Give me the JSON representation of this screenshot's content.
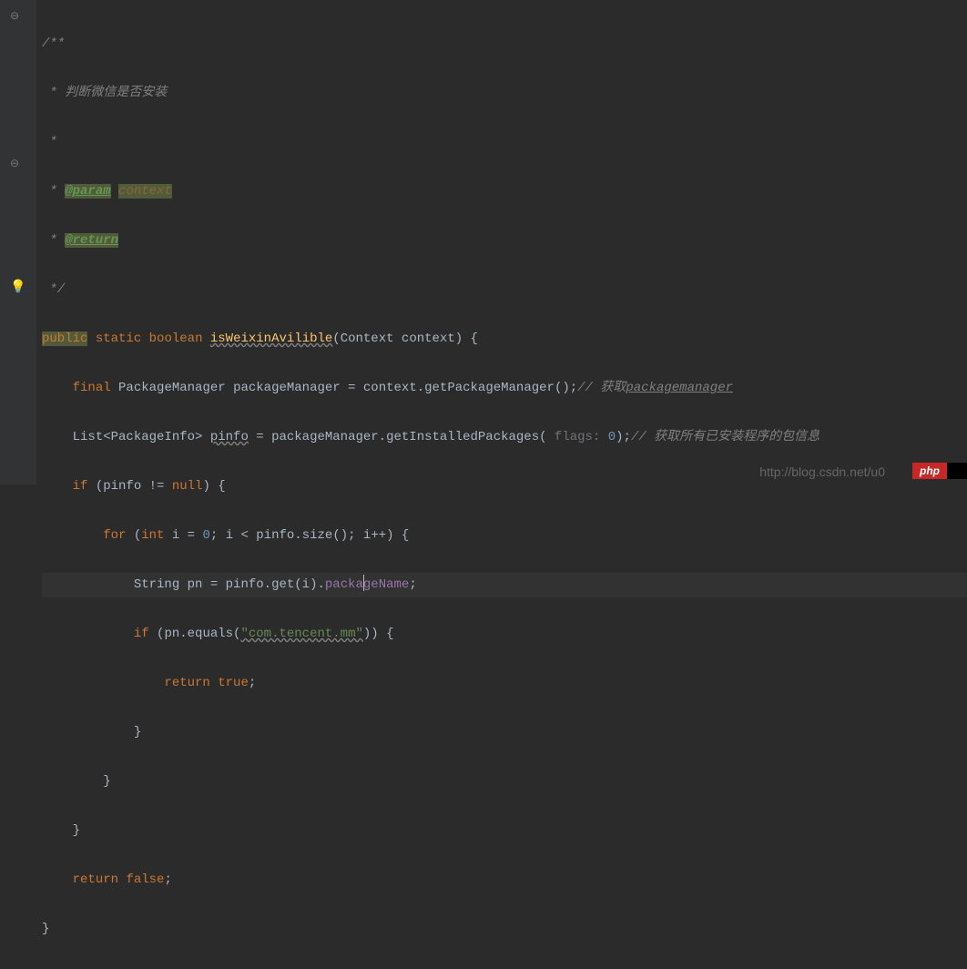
{
  "code": {
    "doc_open": "/**",
    "doc_desc": " * 判断微信是否安装",
    "doc_empty": " *",
    "doc_param_tag": "@param",
    "doc_param_name": "context",
    "doc_return_tag": "@return",
    "doc_close": " */",
    "kw_public": "public",
    "kw_static": "static",
    "kw_boolean": "boolean",
    "method_name": "isWeixinAvilible",
    "param_type": "Context",
    "param_name": "context",
    "brace_open": " {",
    "kw_final": "final",
    "type_pm": "PackageManager",
    "var_pm": "packageManager",
    "assign": " = ",
    "ctx": "context",
    "call_getpm": ".getPackageManager();",
    "cmt1": "// 获取",
    "cmt1b": "packagemanager",
    "type_list": "List<PackageInfo>",
    "var_pinfo": "pinfo",
    "call_getinst": " = packageManager.getInstalledPackages( ",
    "hint_flags": "flags:",
    "zero": "0",
    "close_call": ");",
    "cmt2": "// 获取所有已安装程序的包信息",
    "kw_if": "if",
    "cond1": " (pinfo != ",
    "kw_null": "null",
    "cond1b": ") {",
    "kw_for": "for",
    "for_open": " (",
    "kw_int": "int",
    "for_body1": " i = ",
    "for_body2": "; i < pinfo.size(); i++) {",
    "type_string": "String",
    "var_pn": " pn = pinfo.get(i).",
    "field_pkg1": "packa",
    "field_pkg2": "geName",
    "semi": ";",
    "if2": " (pn.equals(",
    "str_pkg": "\"com.tencent.mm\"",
    "if2b": ")) {",
    "kw_return": "return",
    "kw_true": "true",
    "brace_close": "}",
    "kw_false": "false",
    "ret_semi": ";"
  },
  "watermark": "http://blog.csdn.net/u0",
  "badge": "php"
}
